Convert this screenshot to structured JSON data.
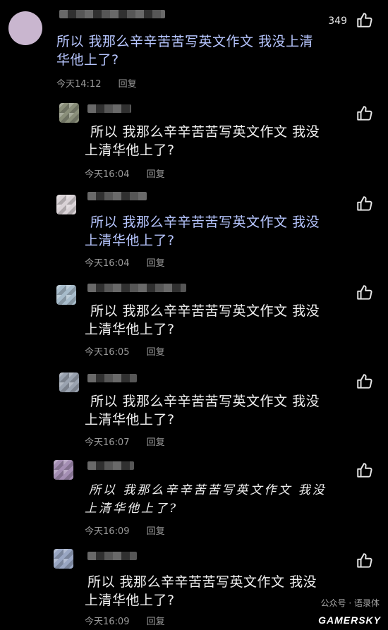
{
  "comments": [
    {
      "text": "所以 我那么辛辛苦苦写英文作文 我没上清\n华他上了?",
      "time": "今天14:12",
      "reply": "回复",
      "likes": "349"
    },
    {
      "text": "所以 我那么辛辛苦苦写英文作文 我没\n上清华他上了?",
      "time": "今天16:04",
      "reply": "回复"
    },
    {
      "text": "所以 我那么辛辛苦苦写英文作文 我没\n上清华他上了?",
      "time": "今天16:04",
      "reply": "回复"
    },
    {
      "text": "所以 我那么辛辛苦苦写英文作文 我没\n上清华他上了?",
      "time": "今天16:05",
      "reply": "回复"
    },
    {
      "text": "所以 我那么辛辛苦苦写英文作文 我没\n上清华他上了?",
      "time": "今天16:07",
      "reply": "回复"
    },
    {
      "text": "所以 我那么辛辛苦苦写英文作文 我没\n上清华他上了?",
      "time": "今天16:09",
      "reply": "回复"
    },
    {
      "text": "所以 我那么辛辛苦苦写英文作文 我没\n上清华他上了?",
      "time": "今天16:09",
      "reply": "回复"
    }
  ],
  "watermark": "公众号 · 语录体",
  "brand": "GAMERSKY",
  "icons": {
    "like": "thumbs-up-icon"
  }
}
